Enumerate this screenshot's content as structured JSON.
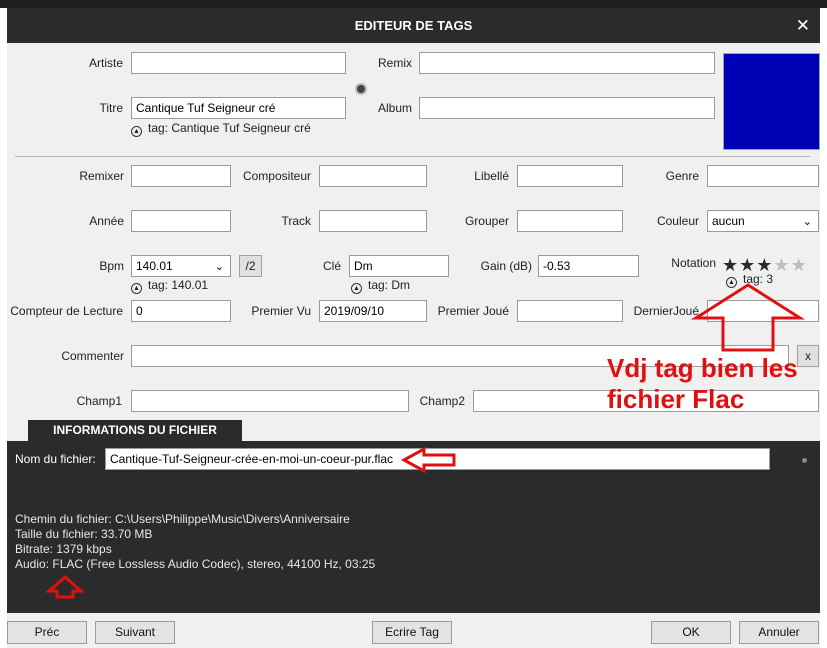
{
  "window": {
    "title": "EDITEUR DE TAGS",
    "close_glyph": "✕"
  },
  "fields": {
    "artiste": {
      "label": "Artiste",
      "value": ""
    },
    "remix": {
      "label": "Remix",
      "value": ""
    },
    "titre": {
      "label": "Titre",
      "value": "Cantique Tuf Seigneur cré",
      "tag": "tag: Cantique Tuf Seigneur cré"
    },
    "album": {
      "label": "Album",
      "value": ""
    },
    "remixer": {
      "label": "Remixer",
      "value": ""
    },
    "compositeur": {
      "label": "Compositeur",
      "value": ""
    },
    "libelle": {
      "label": "Libellé",
      "value": ""
    },
    "genre": {
      "label": "Genre",
      "value": ""
    },
    "annee": {
      "label": "Année",
      "value": ""
    },
    "track": {
      "label": "Track",
      "value": ""
    },
    "grouper": {
      "label": "Grouper",
      "value": ""
    },
    "couleur": {
      "label": "Couleur",
      "value": "aucun"
    },
    "bpm": {
      "label": "Bpm",
      "value": "140.01",
      "tag": "tag: 140.01",
      "half_button": "/2"
    },
    "cle": {
      "label": "Clé",
      "value": "Dm",
      "tag": "tag: Dm"
    },
    "gain": {
      "label": "Gain (dB)",
      "value": "-0.53"
    },
    "notation": {
      "label": "Notation",
      "rating": 3,
      "max": 5,
      "tag": "tag: 3"
    },
    "compteur": {
      "label": "Compteur de Lecture",
      "value": "0"
    },
    "premier_vu": {
      "label": "Premier Vu",
      "value": "2019/09/10"
    },
    "premier_joue": {
      "label": "Premier Joué",
      "value": ""
    },
    "dernier_joue": {
      "label": "DernierJoué",
      "value": ""
    },
    "commenter": {
      "label": "Commenter",
      "value": "",
      "clear_label": "x"
    },
    "champ1": {
      "label": "Champ1",
      "value": ""
    },
    "champ2": {
      "label": "Champ2",
      "value": ""
    }
  },
  "cover_color": "#0000b4",
  "info": {
    "tab": "INFORMATIONS DU FICHIER",
    "filename_label": "Nom du fichier:",
    "filename": "Cantique-Tuf-Seigneur-crée-en-moi-un-coeur-pur.flac",
    "lines": [
      "Chemin du fichier: C:\\Users\\Philippe\\Music\\Divers\\Anniversaire",
      "Taille du fichier: 33.70 MB",
      "Bitrate: 1379 kbps",
      "Audio: FLAC (Free Lossless Audio Codec), stereo, 44100 Hz, 03:25"
    ]
  },
  "annotation": {
    "line1": "Vdj tag bien les",
    "line2": "fichier Flac",
    "color": "#e01010"
  },
  "buttons": {
    "prev": "Préc",
    "next": "Suivant",
    "write": "Ecrire Tag",
    "ok": "OK",
    "cancel": "Annuler"
  }
}
